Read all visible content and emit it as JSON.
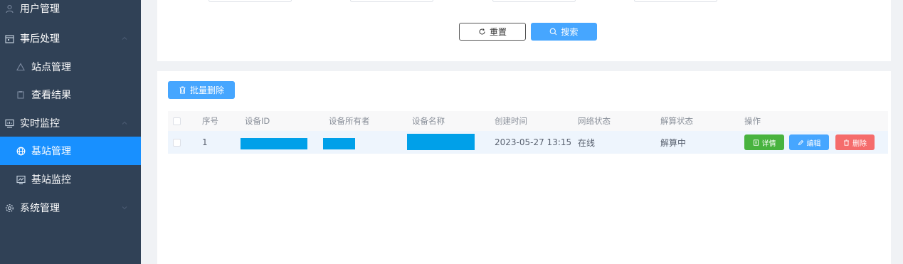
{
  "sidebar": {
    "items": [
      {
        "label": "用户管理",
        "icon": "user-icon"
      },
      {
        "label": "事后处理",
        "icon": "calendar-icon"
      },
      {
        "label": "站点管理",
        "icon": "triangle-icon"
      },
      {
        "label": "查看结果",
        "icon": "clipboard-icon"
      },
      {
        "label": "实时监控",
        "icon": "monitor-icon"
      },
      {
        "label": "基站管理",
        "icon": "globe-icon",
        "active": true
      },
      {
        "label": "基站监控",
        "icon": "chart-window-icon"
      },
      {
        "label": "系统管理",
        "icon": "gear-icon"
      }
    ]
  },
  "search": {
    "reset_label": "重置",
    "search_label": "搜索"
  },
  "toolbar": {
    "batch_delete_label": "批量删除"
  },
  "table": {
    "headers": [
      "序号",
      "设备ID",
      "设备所有者",
      "设备名称",
      "创建时间",
      "网络状态",
      "解算状态",
      "操作"
    ],
    "rows": [
      {
        "index": "1",
        "created_at": "2023-05-27 13:15",
        "network_status": "在线",
        "solve_status": "解算中"
      }
    ],
    "actions": {
      "detail_label": "详情",
      "edit_label": "编辑",
      "delete_label": "删除"
    }
  },
  "colors": {
    "sidebar_bg": "#304156",
    "active_bg": "#1890ff",
    "primary": "#46a6ff",
    "success": "#48b33f",
    "danger": "#f56c6c",
    "redaction": "#00a0e9"
  }
}
